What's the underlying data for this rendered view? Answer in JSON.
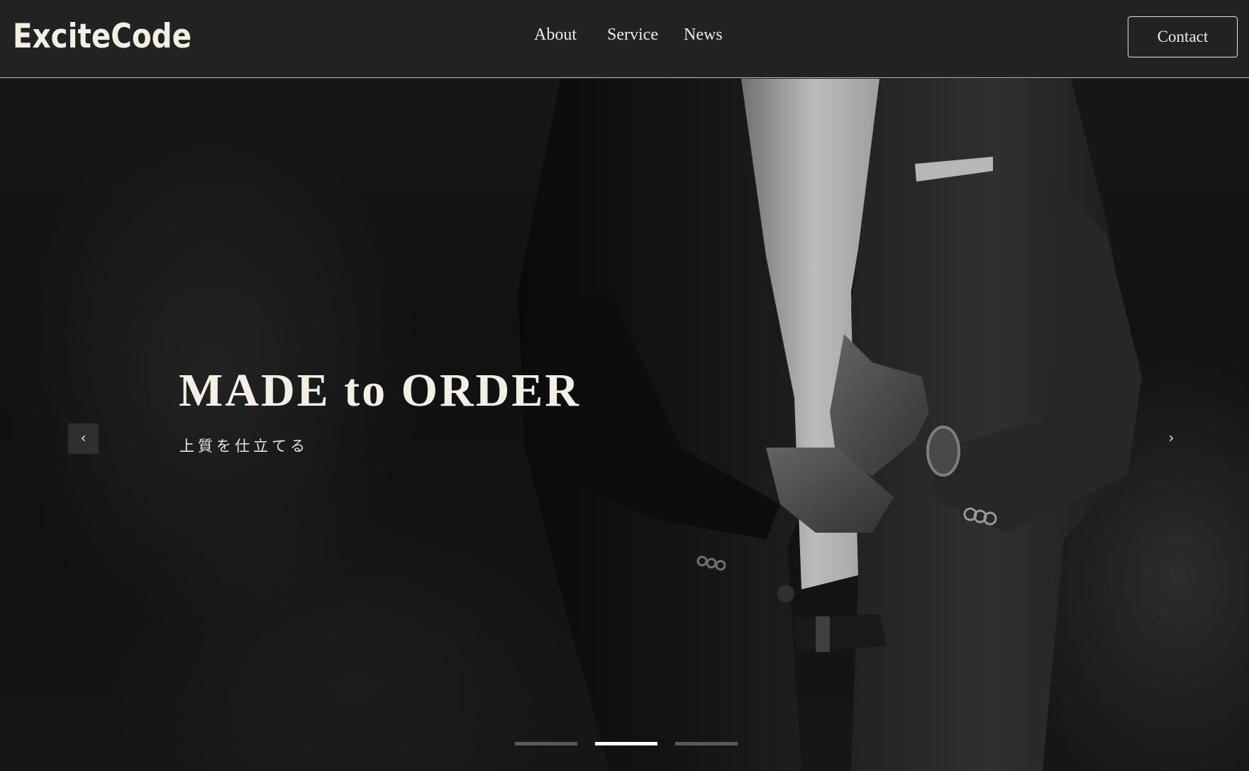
{
  "brand": {
    "logo_text": "ExciteCode"
  },
  "nav": {
    "items": [
      {
        "label": "About"
      },
      {
        "label": "Service"
      },
      {
        "label": "News"
      }
    ],
    "contact_label": "Contact"
  },
  "hero": {
    "title": "MADE to ORDER",
    "subtitle": "上質を仕立てる",
    "prev_icon": "chevron-left-icon",
    "next_icon": "chevron-right-icon",
    "prev_glyph": "‹",
    "next_glyph": "›",
    "slides_total": 3,
    "active_slide": 2,
    "image_description_icon": "man-in-suit-adjusting-cuff"
  },
  "colors": {
    "header_bg": "#222222",
    "text_cream": "#f4efe4",
    "hero_bg": "#181818",
    "indicator_active": "#ffffff",
    "indicator_inactive": "#5a5a5a"
  }
}
